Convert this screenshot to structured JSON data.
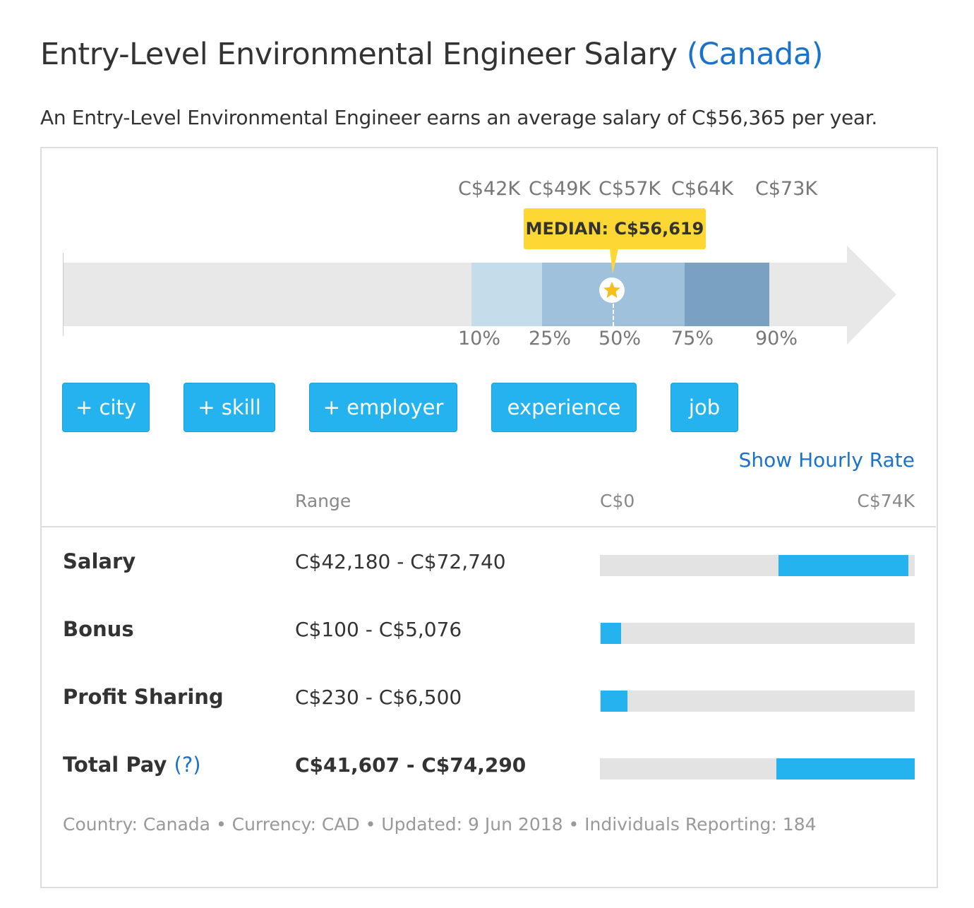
{
  "title": "Entry-Level Environmental Engineer Salary",
  "country_link": "(Canada)",
  "lead": "An Entry-Level Environmental Engineer earns an average salary of C$56,365 per year.",
  "chart": {
    "value_labels": [
      "C$42K",
      "C$49K",
      "C$57K",
      "C$64K",
      "C$73K"
    ],
    "percentile_labels": [
      "10%",
      "25%",
      "50%",
      "75%",
      "90%"
    ],
    "median_label": "MEDIAN: C$56,619",
    "colors": {
      "p10_25": "#c5dcea",
      "p25_75": "#9fc1db",
      "p75_90": "#7aa1c1",
      "median_badge": "#fdd835"
    }
  },
  "buttons": [
    "+ city",
    "+ skill",
    "+ employer",
    "experience",
    "job"
  ],
  "show_hourly": "Show Hourly Rate",
  "table": {
    "headers": {
      "range": "Range",
      "min": "C$0",
      "max": "C$74K"
    },
    "scale_max": 74290,
    "rows": [
      {
        "label": "Salary",
        "range": "C$42,180 - C$72,740",
        "low": 42180,
        "high": 72740
      },
      {
        "label": "Bonus",
        "range": "C$100 - C$5,076",
        "low": 100,
        "high": 5076
      },
      {
        "label": "Profit Sharing",
        "range": "C$230 - C$6,500",
        "low": 230,
        "high": 6500
      },
      {
        "label": "Total Pay",
        "help": "(?)",
        "range": "C$41,607 - C$74,290",
        "low": 41607,
        "high": 74290
      }
    ]
  },
  "footer": "Country: Canada • Currency: CAD • Updated: 9 Jun 2018 • Individuals Reporting: 184"
}
